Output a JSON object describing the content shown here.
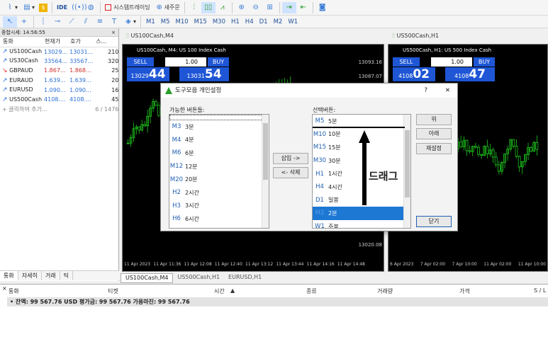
{
  "toolbar1": {
    "items": [
      "IDE",
      "시스템트레이딩",
      "새주문"
    ]
  },
  "toolbar2": {
    "timeframes": [
      "M1",
      "M5",
      "M10",
      "M15",
      "M30",
      "H1",
      "H4",
      "D1",
      "M2",
      "W1"
    ]
  },
  "market_watch": {
    "title": "종합시세: 14:56:55",
    "columns": [
      "통화",
      "현재가",
      "호가",
      "스..."
    ],
    "rows": [
      {
        "symbol": "US100Cash",
        "bid": "13029...",
        "ask": "13031...",
        "spread": "210",
        "dir": "up"
      },
      {
        "symbol": "US30Cash",
        "bid": "33564...",
        "ask": "33567...",
        "spread": "320",
        "dir": "up"
      },
      {
        "symbol": "GBPAUD",
        "bid": "1.867...",
        "ask": "1.868...",
        "spread": "25",
        "dir": "down"
      },
      {
        "symbol": "EURAUD",
        "bid": "1.639...",
        "ask": "1.639...",
        "spread": "20",
        "dir": "up"
      },
      {
        "symbol": "EURUSD",
        "bid": "1.090...",
        "ask": "1.090...",
        "spread": "16",
        "dir": "up"
      },
      {
        "symbol": "US500Cash",
        "bid": "4108....",
        "ask": "4108....",
        "spread": "45",
        "dir": "up"
      }
    ],
    "add_label": "클릭하여 추가...",
    "count": "6 / 1476",
    "tabs": [
      "통화",
      "자세히",
      "거래",
      "틱"
    ]
  },
  "chart1": {
    "window_title": "US100Cash,M4",
    "info": "US100Cash, M4: US 100 Index Cash",
    "sell": "SELL",
    "buy": "BUY",
    "lot": "1.00",
    "sell_small": "13029",
    "sell_big": "44",
    "buy_small": "13031",
    "buy_big": "54",
    "prices": [
      "13093.16",
      "13087.07",
      "13020.08"
    ],
    "dates": [
      "11 Apr 2023",
      "11 Apr 11:36",
      "11 Apr 12:08",
      "11 Apr 12:40",
      "11 Apr 13:12",
      "11 Apr 13:44",
      "11 Apr 14:16",
      "11 Apr 14:48"
    ]
  },
  "chart2": {
    "window_title": "US500Cash,H1",
    "info": "US500Cash, H1: US 500 Index Cash",
    "sell": "SELL",
    "buy": "BUY",
    "lot": "1.00",
    "sell_small": "4108",
    "sell_big": "02",
    "buy_small": "4108",
    "buy_big": "47",
    "dates": [
      "6 Apr 2023",
      "7 Apr 02:00",
      "7 Apr 10:00",
      "11 Apr 02:00",
      "11 Apr 10:00"
    ]
  },
  "chart_tabs": [
    "US100Cash,M4",
    "US500Cash,H1",
    "EURUSD,H1"
  ],
  "dialog": {
    "title": "도구모음 개인설정",
    "help": "?",
    "close": "✕",
    "available_label": "가능한 버튼들:",
    "selected_label": "선택버튼:",
    "available": [
      {
        "code": "",
        "name": ""
      },
      {
        "code": "M3",
        "name": "3분"
      },
      {
        "code": "M4",
        "name": "4분"
      },
      {
        "code": "M6",
        "name": "6분"
      },
      {
        "code": "M12",
        "name": "12분"
      },
      {
        "code": "M20",
        "name": "20분"
      },
      {
        "code": "H2",
        "name": "2시간"
      },
      {
        "code": "H3",
        "name": "3시간"
      },
      {
        "code": "H6",
        "name": "6시간"
      }
    ],
    "selected": [
      {
        "code": "M5",
        "name": "5분"
      },
      {
        "code": "M10",
        "name": "10분"
      },
      {
        "code": "M15",
        "name": "15분"
      },
      {
        "code": "M30",
        "name": "30분"
      },
      {
        "code": "H1",
        "name": "1시간"
      },
      {
        "code": "H4",
        "name": "4시간"
      },
      {
        "code": "D1",
        "name": "일봉"
      },
      {
        "code": "M2",
        "name": "2분"
      },
      {
        "code": "W1",
        "name": "주봉"
      }
    ],
    "insert": "삽입 ->",
    "delete": "<- 삭제",
    "up": "위",
    "down": "아래",
    "reset": "재설정",
    "close_btn": "닫기",
    "drag_label": "드래그"
  },
  "terminal": {
    "columns": [
      "통화",
      "티켓",
      "시간",
      "종류",
      "거래량",
      "가격",
      "S / L"
    ],
    "balance": "잔액: 99 567.76 USD  평가금: 99 567.76  가용마진: 99 567.76"
  }
}
